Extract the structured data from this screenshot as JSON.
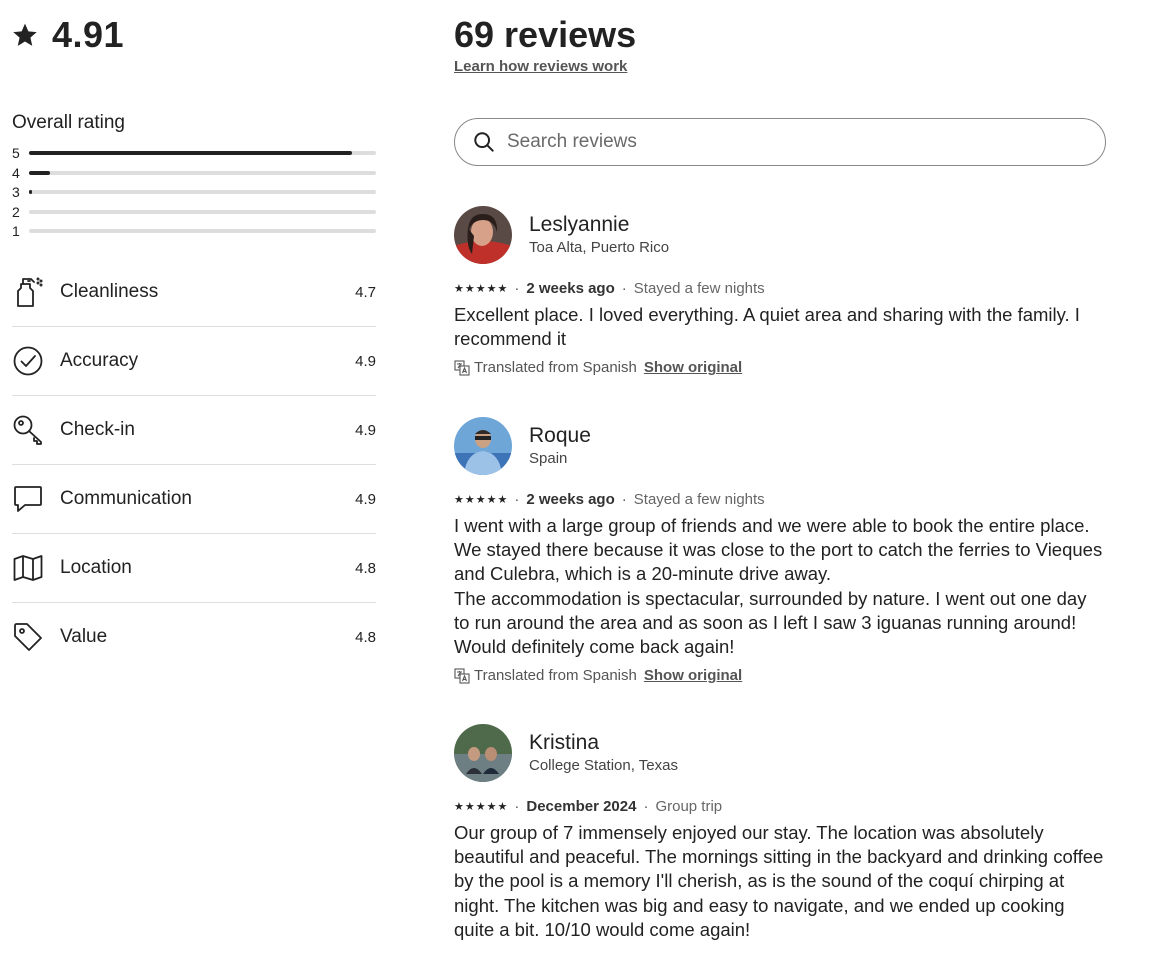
{
  "summary": {
    "average": "4.91",
    "overall_label": "Overall rating",
    "distribution": [
      {
        "label": "5",
        "fraction": 0.93
      },
      {
        "label": "4",
        "fraction": 0.06
      },
      {
        "label": "3",
        "fraction": 0.01
      },
      {
        "label": "2",
        "fraction": 0
      },
      {
        "label": "1",
        "fraction": 0
      }
    ],
    "categories": [
      {
        "name": "Cleanliness",
        "score": "4.7",
        "icon": "spray-bottle-icon"
      },
      {
        "name": "Accuracy",
        "score": "4.9",
        "icon": "check-circle-icon"
      },
      {
        "name": "Check-in",
        "score": "4.9",
        "icon": "key-icon"
      },
      {
        "name": "Communication",
        "score": "4.9",
        "icon": "chat-bubble-icon"
      },
      {
        "name": "Location",
        "score": "4.8",
        "icon": "map-icon"
      },
      {
        "name": "Value",
        "score": "4.8",
        "icon": "tag-icon"
      }
    ]
  },
  "header": {
    "count": "69 reviews",
    "learn_link": "Learn how reviews work"
  },
  "search": {
    "placeholder": "Search reviews"
  },
  "reviews": [
    {
      "name": "Leslyannie",
      "location": "Toa Alta, Puerto Rico",
      "stars": 5,
      "when": "2 weeks ago",
      "stay": "Stayed a few nights",
      "text": "Excellent place. I loved everything. A quiet area and sharing with the family. I recommend it",
      "translated": "Translated from Spanish",
      "show_original": "Show original"
    },
    {
      "name": "Roque",
      "location": "Spain",
      "stars": 5,
      "when": "2 weeks ago",
      "stay": "Stayed a few nights",
      "text_lines": [
        "I went with a large group of friends and we were able to book the entire place. We stayed there because it was close to the port to catch the ferries to Vieques and Culebra, which is a 20-minute drive away.",
        "The accommodation is spectacular, surrounded by nature. I went out one day to run around the area and as soon as I left I saw 3 iguanas running around!",
        "Would definitely come back again!"
      ],
      "translated": "Translated from Spanish",
      "show_original": "Show original"
    },
    {
      "name": "Kristina",
      "location": "College Station, Texas",
      "stars": 5,
      "when": "December 2024",
      "stay": "Group trip",
      "text": "Our group of 7 immensely enjoyed our stay. The location was absolutely beautiful and peaceful. The mornings sitting in the backyard and drinking coffee by the pool is a memory I'll cherish, as is the sound of the coquí chirping at night. The kitchen was big and easy to navigate, and we ended up cooking quite a bit. 10/10 would come again!"
    }
  ]
}
